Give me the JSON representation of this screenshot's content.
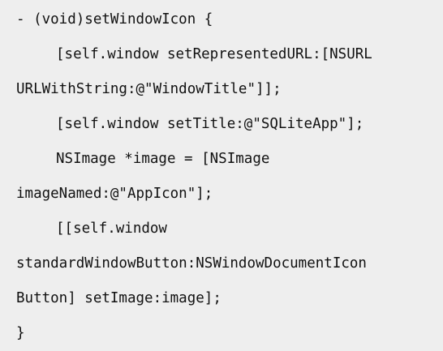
{
  "code": {
    "lines": [
      "- (void)setWindowIcon {",
      "[self.window setRepresentedURL:[NSURL",
      "URLWithString:@\"WindowTitle\"]];",
      "[self.window setTitle:@\"SQLiteApp\"];",
      "NSImage *image = [NSImage",
      "imageNamed:@\"AppIcon\"];",
      "[[self.window",
      "standardWindowButton:NSWindowDocumentIcon",
      "Button] setImage:image];",
      "}"
    ]
  }
}
